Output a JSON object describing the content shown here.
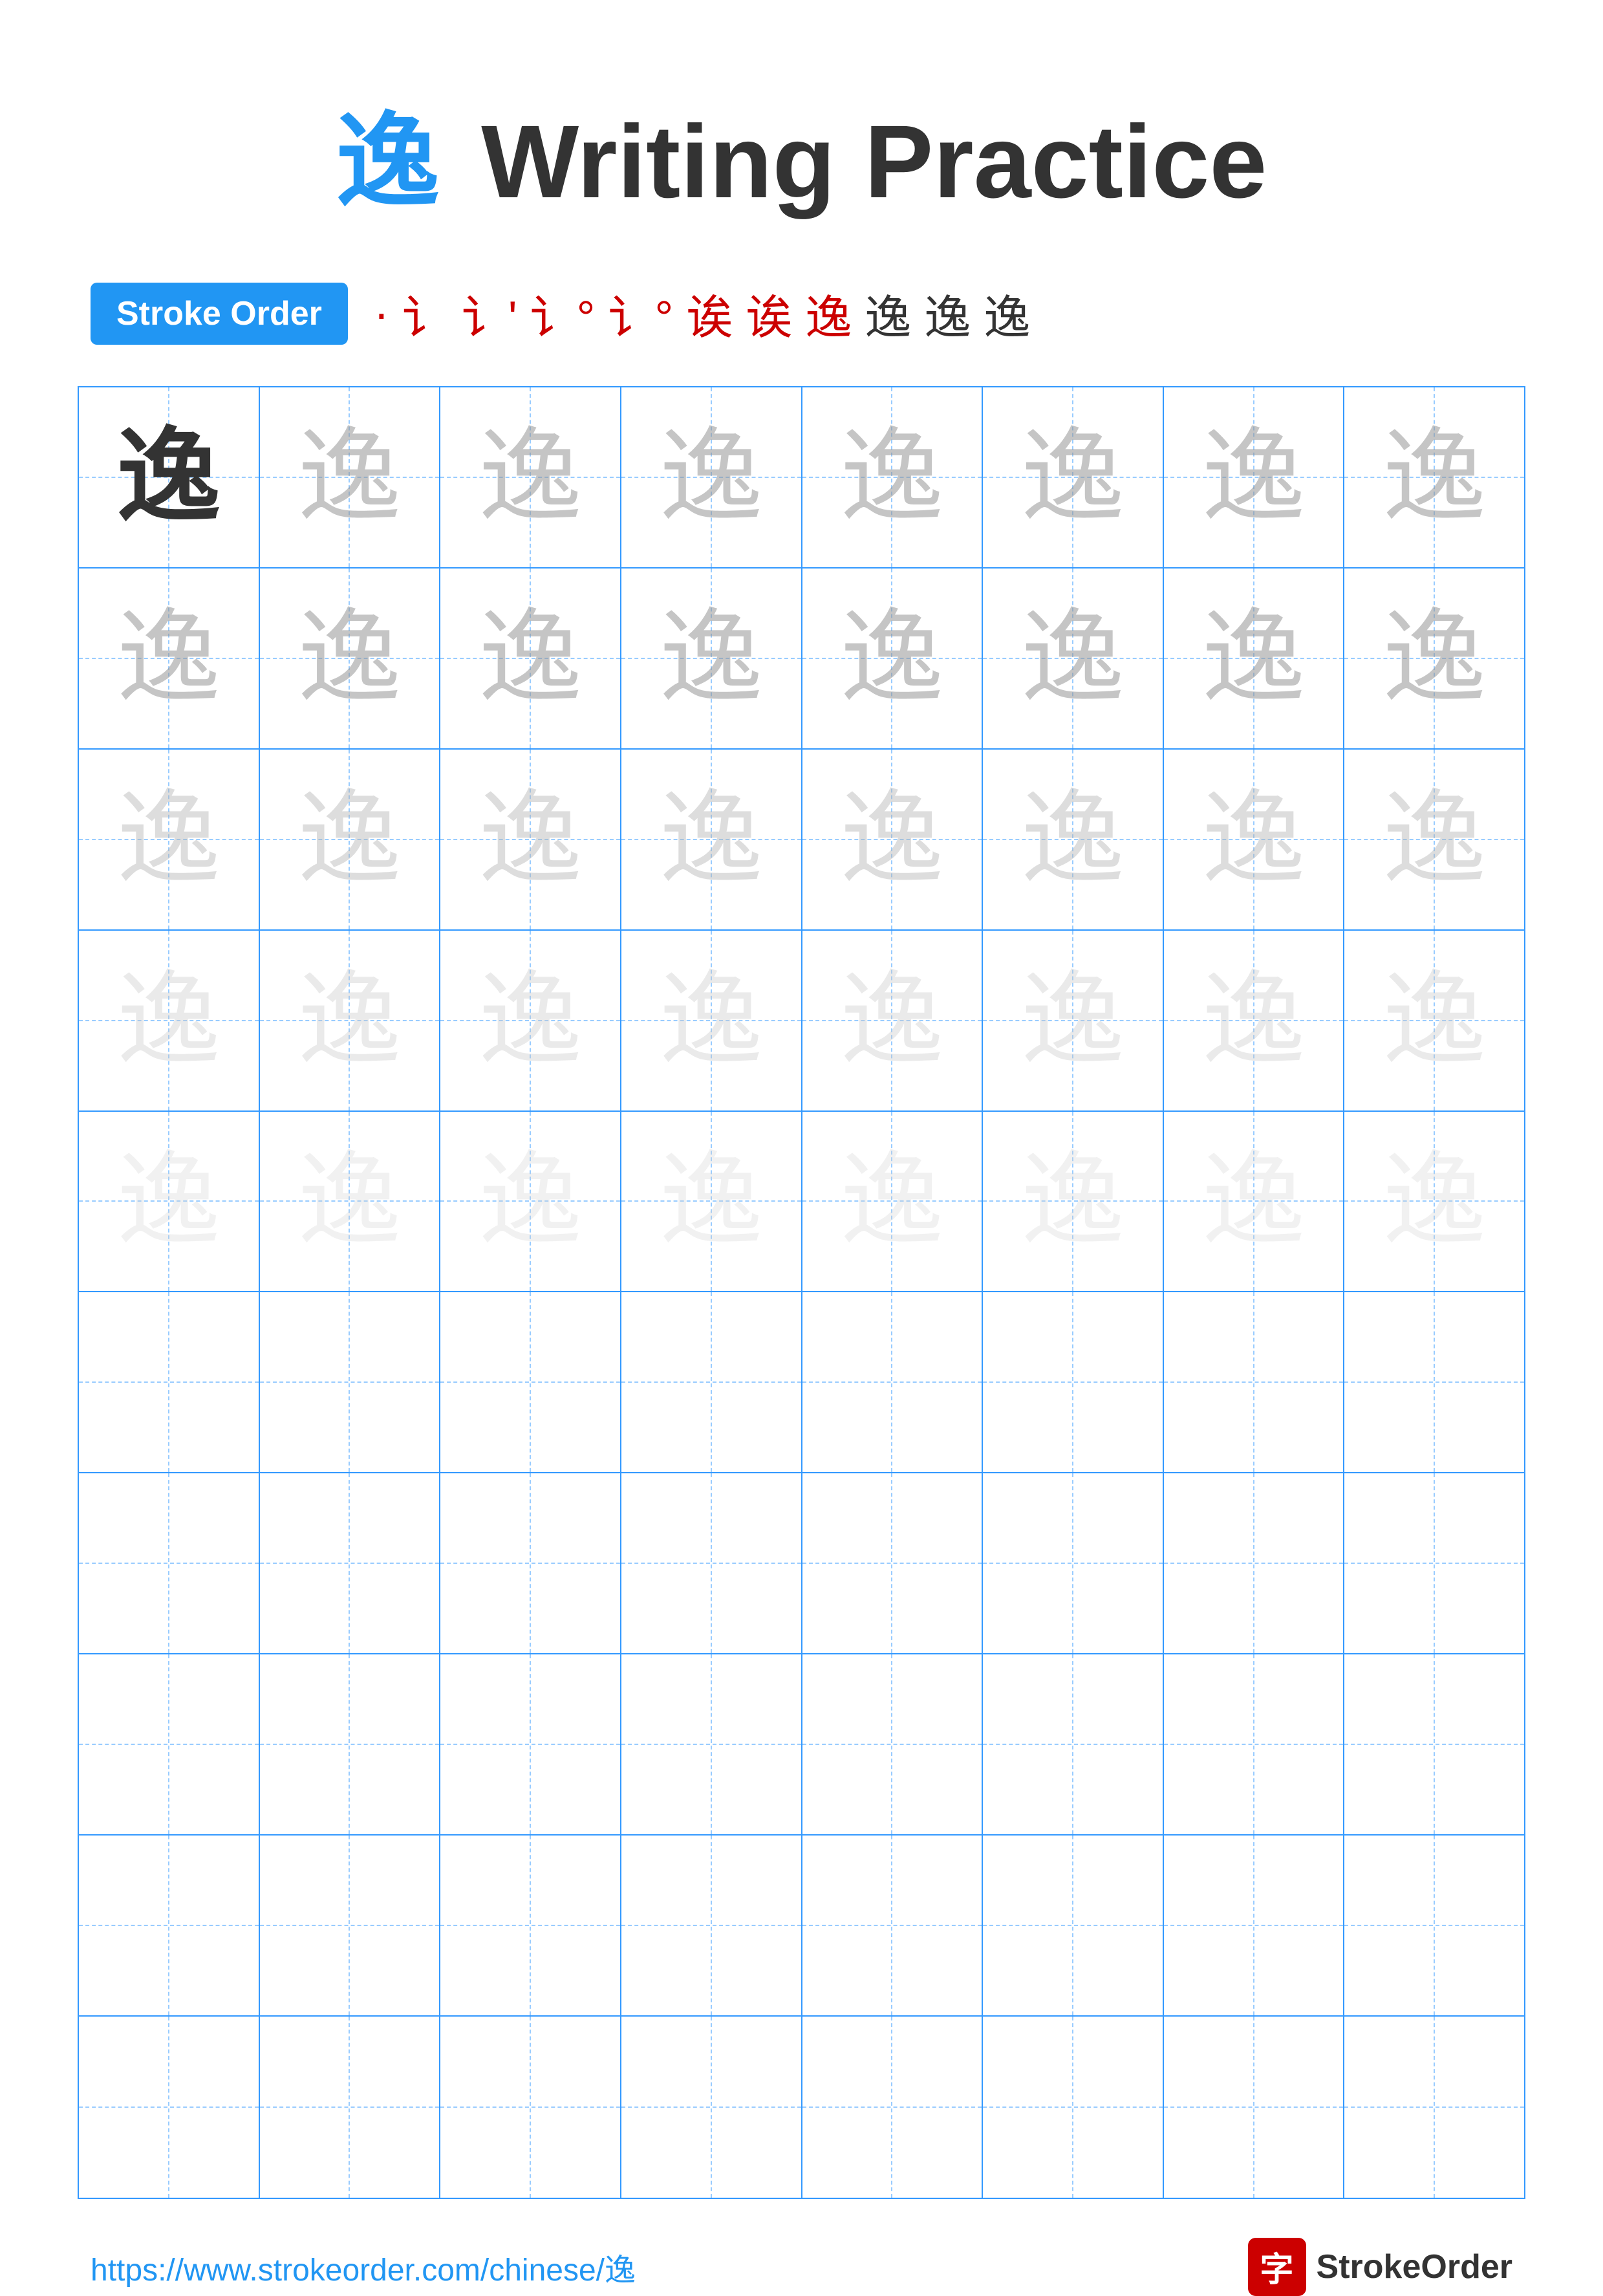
{
  "title": {
    "char": "逸",
    "text": "Writing Practice"
  },
  "stroke_order": {
    "badge_label": "Stroke Order",
    "strokes": [
      "·",
      "i",
      "i'",
      "i°",
      "i°",
      "i诶",
      "i诶",
      "诶诶",
      "逸诶",
      "逸诶",
      "逸"
    ]
  },
  "grid": {
    "rows": 10,
    "cols": 8,
    "character": "逸",
    "char_rows": [
      [
        "dark",
        "light1",
        "light1",
        "light1",
        "light1",
        "light1",
        "light1",
        "light1"
      ],
      [
        "light1",
        "light1",
        "light1",
        "light1",
        "light1",
        "light1",
        "light1",
        "light1"
      ],
      [
        "light2",
        "light2",
        "light2",
        "light2",
        "light2",
        "light2",
        "light2",
        "light2"
      ],
      [
        "light3",
        "light3",
        "light3",
        "light3",
        "light3",
        "light3",
        "light3",
        "light3"
      ],
      [
        "light4",
        "light4",
        "light4",
        "light4",
        "light4",
        "light4",
        "light4",
        "light4"
      ],
      [
        "empty",
        "empty",
        "empty",
        "empty",
        "empty",
        "empty",
        "empty",
        "empty"
      ],
      [
        "empty",
        "empty",
        "empty",
        "empty",
        "empty",
        "empty",
        "empty",
        "empty"
      ],
      [
        "empty",
        "empty",
        "empty",
        "empty",
        "empty",
        "empty",
        "empty",
        "empty"
      ],
      [
        "empty",
        "empty",
        "empty",
        "empty",
        "empty",
        "empty",
        "empty",
        "empty"
      ],
      [
        "empty",
        "empty",
        "empty",
        "empty",
        "empty",
        "empty",
        "empty",
        "empty"
      ]
    ]
  },
  "footer": {
    "url": "https://www.strokeorder.com/chinese/逸",
    "logo_char": "字",
    "logo_text": "StrokeOrder"
  }
}
